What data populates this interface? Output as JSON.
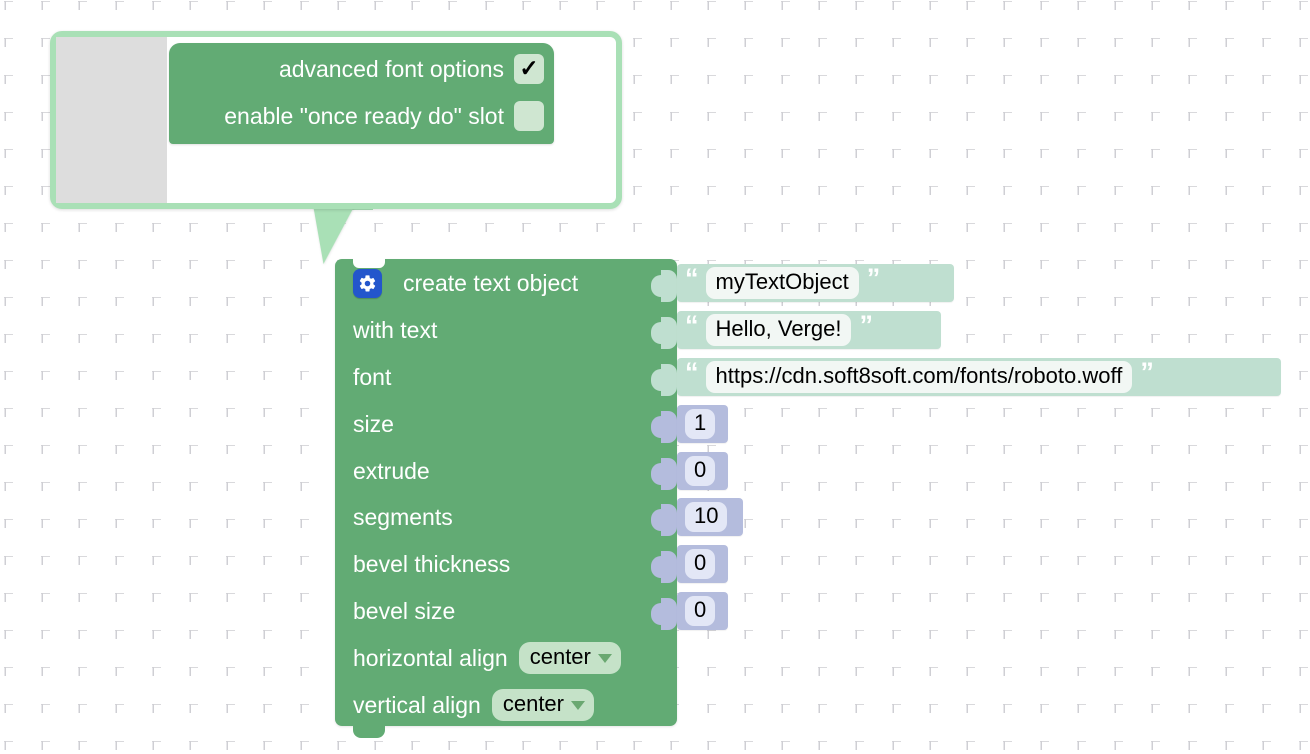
{
  "workspace": {
    "background": "#ffffff",
    "grid_color": "#cfcfd4"
  },
  "mutator_bubble": {
    "name": "mutator-bubble",
    "border_color": "#a9e0b6",
    "block_color": "#62ab74",
    "options": [
      {
        "label": "advanced font options",
        "checked": true,
        "check_glyph": "✓"
      },
      {
        "label": "enable \"once ready do\" slot",
        "checked": false,
        "check_glyph": ""
      }
    ]
  },
  "main_block": {
    "name": "create-text-object-block",
    "color": "#62ab74",
    "gear_icon": "gear-icon",
    "title": "create text object",
    "rows": [
      {
        "label": "with text"
      },
      {
        "label": "font"
      },
      {
        "label": "size"
      },
      {
        "label": "extrude"
      },
      {
        "label": "segments"
      },
      {
        "label": "bevel thickness"
      },
      {
        "label": "bevel size"
      },
      {
        "label": "horizontal align"
      },
      {
        "label": "vertical align"
      }
    ],
    "dropdowns": [
      {
        "name": "horizontal-align-dropdown",
        "value": "center"
      },
      {
        "name": "vertical-align-dropdown",
        "value": "center"
      }
    ]
  },
  "values": {
    "string_color": "#bfdfd0",
    "number_color": "#b4bcdd",
    "quote_open": "“",
    "quote_close": "”",
    "strings": [
      {
        "name": "text-object-name-value",
        "text": "myTextObject"
      },
      {
        "name": "with-text-value",
        "text": "Hello, Verge!"
      },
      {
        "name": "font-url-value",
        "text": "https://cdn.soft8soft.com/fonts/roboto.woff"
      }
    ],
    "numbers": [
      {
        "name": "size-value",
        "text": "1"
      },
      {
        "name": "extrude-value",
        "text": "0"
      },
      {
        "name": "segments-value",
        "text": "10"
      },
      {
        "name": "bevel-thickness-value",
        "text": "0"
      },
      {
        "name": "bevel-size-value",
        "text": "0"
      }
    ]
  }
}
